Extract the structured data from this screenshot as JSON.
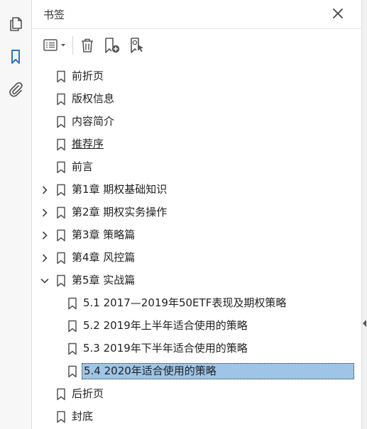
{
  "panel": {
    "title": "书签"
  },
  "colors": {
    "accent": "#2b73c8",
    "selection": "#9ec5e5",
    "icon": "#555555"
  },
  "rail": {
    "icons": [
      "pages-icon",
      "bookmark-icon",
      "attachment-icon"
    ],
    "active": "bookmark-icon"
  },
  "toolbar": {
    "icons": [
      "options-menu-icon",
      "delete-bookmark-icon",
      "new-bookmark-icon",
      "find-current-bookmark-icon"
    ]
  },
  "bookmarks": [
    {
      "label": "前折页",
      "level": 0,
      "expander": "none"
    },
    {
      "label": "版权信息",
      "level": 0,
      "expander": "none"
    },
    {
      "label": "内容简介",
      "level": 0,
      "expander": "none"
    },
    {
      "label": "推荐序",
      "level": 0,
      "expander": "none",
      "underline": true
    },
    {
      "label": "前言",
      "level": 0,
      "expander": "none"
    },
    {
      "label": "第1章 期权基础知识",
      "level": 0,
      "expander": "collapsed"
    },
    {
      "label": "第2章 期权实务操作",
      "level": 0,
      "expander": "collapsed"
    },
    {
      "label": "第3章 策略篇",
      "level": 0,
      "expander": "collapsed"
    },
    {
      "label": "第4章 风控篇",
      "level": 0,
      "expander": "collapsed"
    },
    {
      "label": "第5章 实战篇",
      "level": 0,
      "expander": "expanded"
    },
    {
      "label": "5.1 2017—2019年50ETF表现及期权策略",
      "level": 1,
      "expander": "none"
    },
    {
      "label": "5.2 2019年上半年适合使用的策略",
      "level": 1,
      "expander": "none"
    },
    {
      "label": "5.3 2019年下半年适合使用的策略",
      "level": 1,
      "expander": "none"
    },
    {
      "label": "5.4 2020年适合使用的策略",
      "level": 1,
      "expander": "none",
      "selected": true
    },
    {
      "label": "后折页",
      "level": 0,
      "expander": "none"
    },
    {
      "label": "封底",
      "level": 0,
      "expander": "none"
    }
  ]
}
